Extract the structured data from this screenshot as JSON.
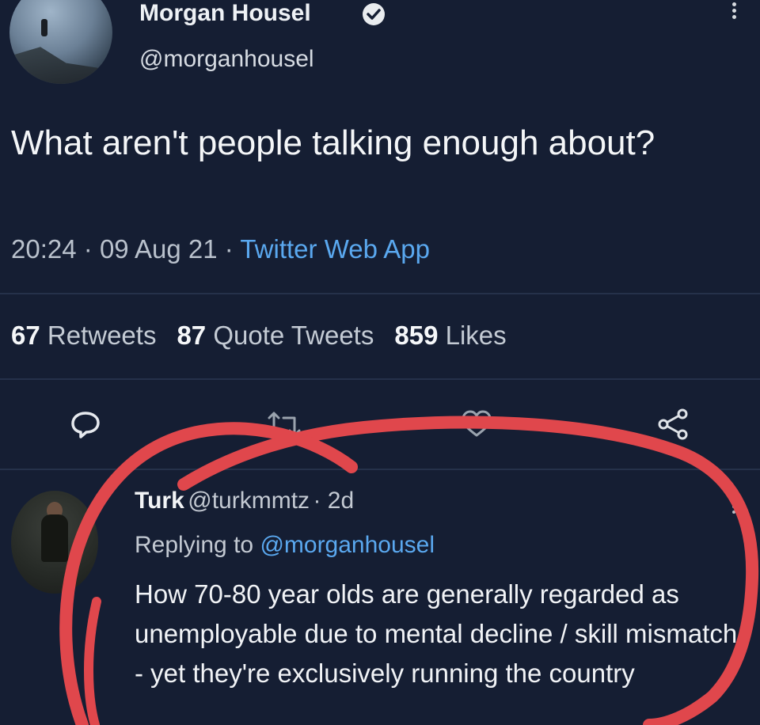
{
  "tweet": {
    "author_name": "Morgan Housel",
    "author_handle": "@morganhousel",
    "text": "What aren't people talking enough about?",
    "time": "20:24",
    "date": "09 Aug 21",
    "source": "Twitter Web App",
    "dot1": "·",
    "dot2": "·",
    "stats": {
      "retweets_count": "67",
      "retweets_label": "Retweets",
      "quotes_count": "87",
      "quotes_label": "Quote Tweets",
      "likes_count": "859",
      "likes_label": "Likes"
    },
    "actions": [
      "reply-icon",
      "retweet-icon",
      "like-icon",
      "share-icon"
    ],
    "verified_icon": "verified-badge-icon",
    "more_icon": "more-vertical-icon"
  },
  "reply": {
    "author_name": "Turk",
    "author_handle": "@turkmmtz",
    "age": "· 2d",
    "replying_prefix": "Replying to",
    "replying_to": "@morganhousel",
    "text": "How 70-80 year olds are generally regarded as unemployable due to mental decline / skill mismatch - yet they're exclusively running the country"
  },
  "colors": {
    "background": "#151e33",
    "link": "#5aa8ef",
    "annotation": "#e0474c"
  }
}
